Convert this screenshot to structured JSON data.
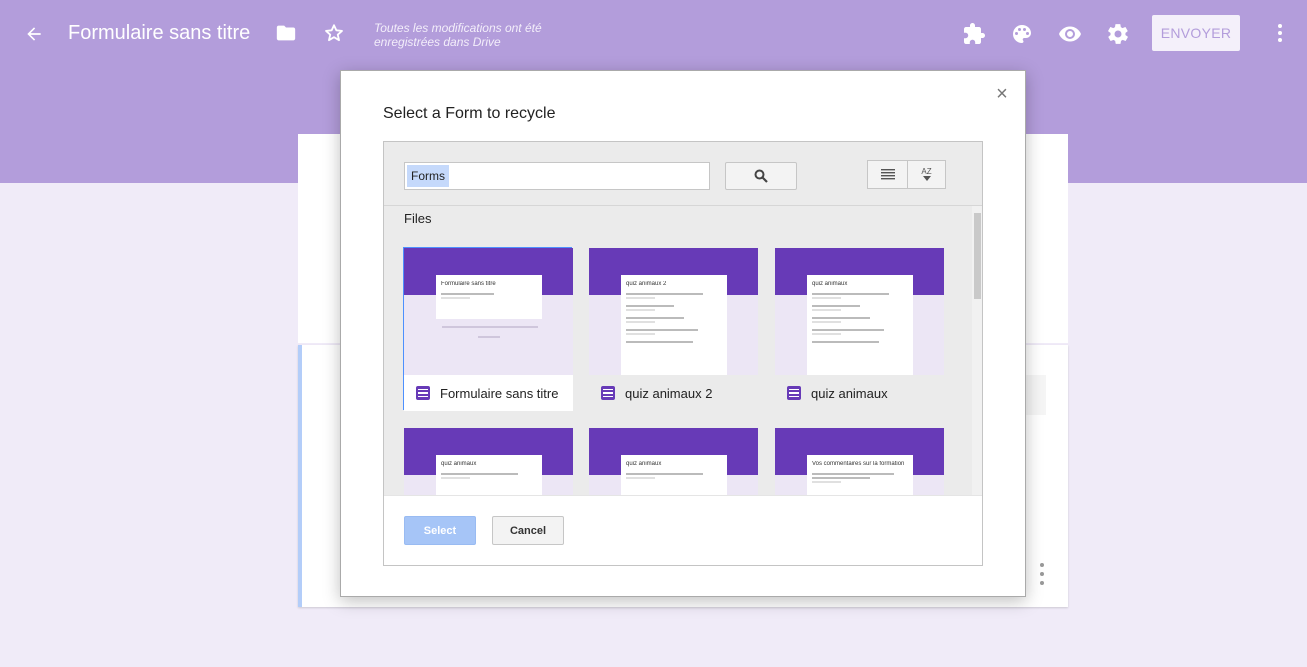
{
  "header": {
    "title": "Formulaire sans titre",
    "save_status": "Toutes les modifications ont été enregistrées dans Drive",
    "send_label": "ENVOYER",
    "icons": [
      "back-arrow-icon",
      "folder-icon",
      "star-icon",
      "addon-icon",
      "palette-icon",
      "preview-icon",
      "settings-icon",
      "more-vert-icon"
    ],
    "color": "#b39ddb"
  },
  "dialog": {
    "title": "Select a Form to recycle",
    "close_glyph": "×",
    "search": {
      "chip": "Forms"
    },
    "section_label": "Files",
    "sort_top": "A",
    "sort_bottom": "Z",
    "files": [
      {
        "name": "Formulaire sans titre",
        "thumb_title": "Formulaire sans titre"
      },
      {
        "name": "quiz animaux 2",
        "thumb_title": "quiz animaux 2"
      },
      {
        "name": "quiz animaux",
        "thumb_title": "quiz animaux"
      },
      {
        "name": "",
        "thumb_title": "quiz animaux"
      },
      {
        "name": "",
        "thumb_title": "quiz animaux"
      },
      {
        "name": "",
        "thumb_title": "Vos commentaires sur la formation"
      }
    ],
    "select_label": "Select",
    "cancel_label": "Cancel",
    "accent": "#673ab7"
  }
}
